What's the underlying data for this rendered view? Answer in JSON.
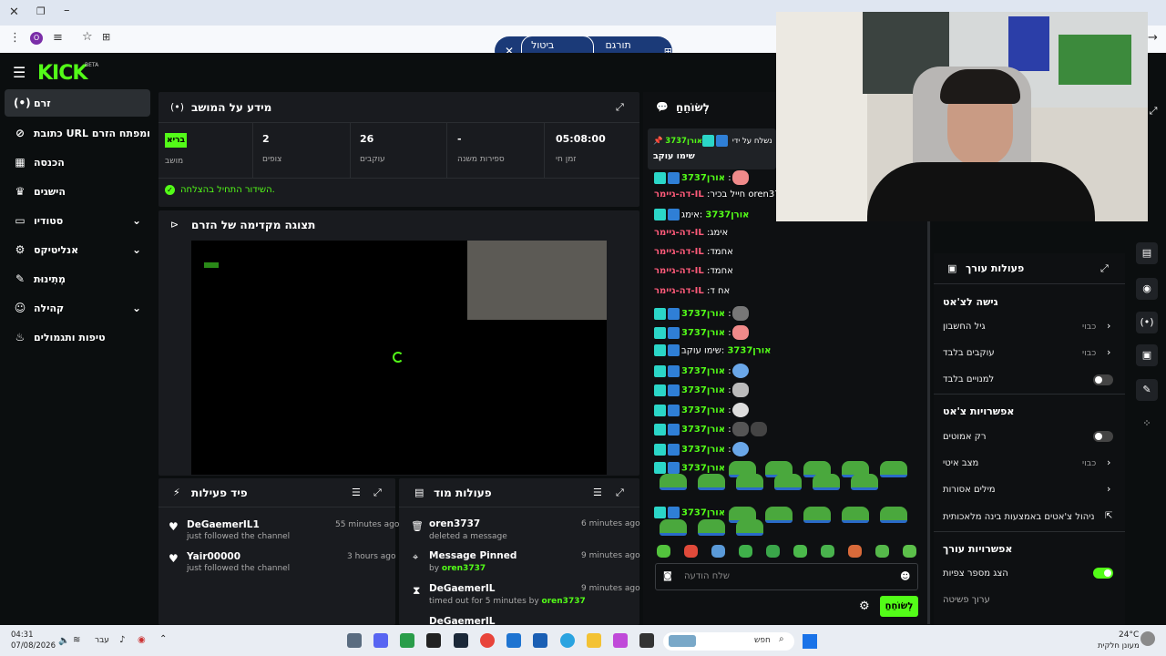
{
  "translate_bar": {
    "label": "תורגם לעברית",
    "cancel": "ביטול הפעולה"
  },
  "logo": {
    "text": "KICK",
    "beta": "BETA"
  },
  "sidebar": {
    "items": [
      {
        "label": "זרם",
        "icon": "broadcast-icon"
      },
      {
        "label": "כתובת URL ומפתח הזרם",
        "icon": "link-icon"
      },
      {
        "label": "הכנסה",
        "icon": "revenue-icon"
      },
      {
        "label": "הישגים",
        "icon": "trophy-icon"
      },
      {
        "label": "סטודיו",
        "icon": "studio-icon"
      },
      {
        "label": "אנליטיקס",
        "icon": "analytics-icon"
      },
      {
        "label": "מְתִינוּת",
        "icon": "wrench-icon"
      },
      {
        "label": "קהילה",
        "icon": "community-icon"
      },
      {
        "label": "טיפות ותגמולים",
        "icon": "rewards-icon"
      }
    ]
  },
  "session": {
    "title": "מידע על המושב",
    "stats": [
      {
        "value": "05:08:00",
        "label": "זמן חי"
      },
      {
        "value": "-",
        "label": "ספירות משנה"
      },
      {
        "value": "26",
        "label": "עוקבים"
      },
      {
        "value": "2",
        "label": "צופים"
      },
      {
        "value": "בריא",
        "label": "מושב"
      }
    ],
    "status": "השידור התחיל בהצלחה."
  },
  "preview": {
    "title": "תצוגה מקדימה של הזרם"
  },
  "activity": {
    "title": "פיד פעילות",
    "items": [
      {
        "name": "DeGaemerIL1",
        "sub": "just followed the channel",
        "time": "55 minutes ago"
      },
      {
        "name": "Yair00000",
        "sub": "just followed the channel",
        "time": "3 hours ago"
      }
    ]
  },
  "mod": {
    "title": "פעולות מוד",
    "items": [
      {
        "name": "oren3737",
        "sub": "deleted a message",
        "by": "",
        "time": "6 minutes ago"
      },
      {
        "name": "Message Pinned",
        "sub": "by",
        "by": "oren3737",
        "time": "9 minutes ago"
      },
      {
        "name": "DeGaemerIL",
        "sub": "timed out for 5 minutes by",
        "by": "oren3737",
        "time": "9 minutes ago"
      },
      {
        "name": "DeGaemerIL",
        "sub": "",
        "by": "",
        "time": ""
      }
    ]
  },
  "chat": {
    "title": "לְשׂוֹחֵחַ",
    "pinned": {
      "by": "נשלח על ידי",
      "user": "אורן3737",
      "text": "שימו עוקב"
    },
    "lines": [
      {
        "user": "אורן3737",
        "text": "",
        "red": false
      },
      {
        "user": "דה-גיימר-IL",
        "text": "חייל בכיר oren3737",
        "red": true
      },
      {
        "user": "אורן3737",
        "text": "אימג",
        "red": false
      },
      {
        "user": "דה-גיימר-IL",
        "text": "אימג",
        "red": true
      },
      {
        "user": "דה-גיימר-IL",
        "text": "אחמד",
        "red": true
      },
      {
        "user": "דה-גיימר-IL",
        "text": "אחמד",
        "red": true
      },
      {
        "user": "דה-גיימר-IL",
        "text": "אח ד",
        "red": true
      },
      {
        "user": "אורן3737",
        "text": "",
        "red": false
      },
      {
        "user": "אורן3737",
        "text": "",
        "red": false
      },
      {
        "user": "אורן3737",
        "text": "שימו עוקב",
        "red": false
      },
      {
        "user": "אורן3737",
        "text": "",
        "red": false
      },
      {
        "user": "אורן3737",
        "text": "",
        "red": false
      },
      {
        "user": "אורן3737",
        "text": "",
        "red": false
      },
      {
        "user": "אורן3737",
        "text": "",
        "red": false
      },
      {
        "user": "אורן3737",
        "text": "",
        "red": false
      },
      {
        "user": "אורן3737",
        "text": "",
        "red": false
      },
      {
        "user": "אורן3737",
        "text": "",
        "red": false
      }
    ],
    "placeholder": "שלח הודעה",
    "send": "לְשׂוֹחֵחַ"
  },
  "editor": {
    "title": "פעולות עורך",
    "chat_access": "גישה לצ'אט",
    "rows": [
      {
        "label": "גיל החשבון",
        "value": "כבוי"
      },
      {
        "label": "עוקבים בלבד",
        "value": "כבוי"
      },
      {
        "label": "למנויים בלבד",
        "value": ""
      }
    ],
    "chat_options": "אפשרויות צ'אט",
    "rows2": [
      {
        "label": "רק אמוטים",
        "value": ""
      },
      {
        "label": "מצב איטי",
        "value": "כבוי"
      },
      {
        "label": "מילים אסורות",
        "value": ""
      },
      {
        "label": "ניהול צ'אטים באמצעות בינה מלאכותית",
        "value": ""
      }
    ],
    "editor_options": "אפשרויות עורך",
    "show_viewers": "הצג מספר צפיות",
    "edit_stream": "ערוך פשיטה"
  },
  "taskbar": {
    "time": "04:31",
    "date": "07/08/2026",
    "lang": "עבר",
    "search": "חפש",
    "weather_temp": "24°C",
    "weather_text": "מעונן חלקית"
  }
}
